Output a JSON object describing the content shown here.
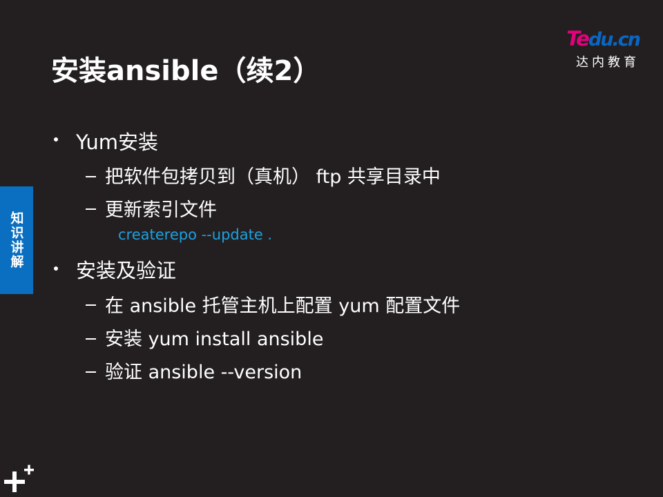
{
  "slide": {
    "title": "安装ansible（续2）"
  },
  "logo": {
    "part1": "Te",
    "part2": "du.cn",
    "subtitle": "达内教育"
  },
  "side_tab": {
    "label": "知识讲解"
  },
  "bullets": [
    {
      "text": "Yum安装",
      "subs": [
        {
          "text": "把软件包拷贝到（真机） ftp 共享目录中"
        },
        {
          "text": "更新索引文件",
          "code": "createrepo  --update  ."
        }
      ]
    },
    {
      "text": "安装及验证",
      "subs": [
        {
          "text": "在 ansible 托管主机上配置 yum 配置文件"
        },
        {
          "text": "安装 yum install ansible"
        },
        {
          "text": "验证 ansible --version"
        }
      ]
    }
  ],
  "colors": {
    "background": "#231f20",
    "accent_blue": "#0a6fc0",
    "code_blue": "#1ba1e2",
    "logo_pink": "#e5007e"
  }
}
